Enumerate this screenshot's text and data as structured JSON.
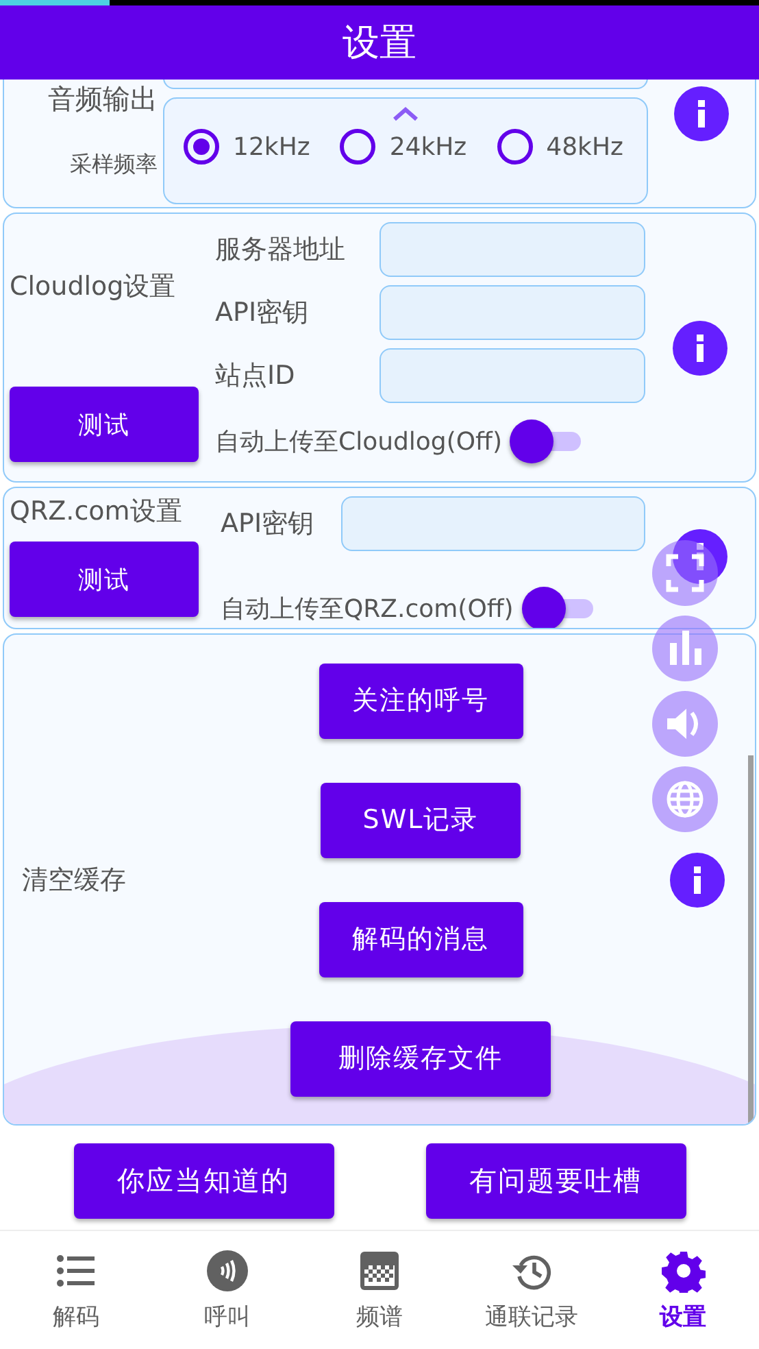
{
  "title": "设置",
  "audio_output": {
    "label": "音频输出"
  },
  "sample_rate": {
    "label": "采样频率",
    "options": [
      {
        "label": "12kHz",
        "selected": true
      },
      {
        "label": "24kHz",
        "selected": false
      },
      {
        "label": "48kHz",
        "selected": false
      }
    ]
  },
  "cloudlog": {
    "title": "Cloudlog设置",
    "test_button": "测试",
    "fields": [
      {
        "label": "服务器地址"
      },
      {
        "label": "API密钥"
      },
      {
        "label": "站点ID"
      }
    ],
    "auto_upload": {
      "label": "自动上传至Cloudlog(Off)",
      "on": false
    }
  },
  "qrz": {
    "title": "QRZ.com设置",
    "test_button": "测试",
    "fields": [
      {
        "label": "API密钥"
      }
    ],
    "auto_upload": {
      "label": "自动上传至QRZ.com(Off)",
      "on": false
    }
  },
  "cache": {
    "label": "清空缓存",
    "buttons": [
      "关注的呼号",
      "SWL记录",
      "解码的消息",
      "删除缓存文件"
    ]
  },
  "footer_buttons": [
    "你应当知道的",
    "有问题要吐槽"
  ],
  "nav": [
    {
      "label": "解码",
      "selected": false
    },
    {
      "label": "呼叫",
      "selected": false
    },
    {
      "label": "频谱",
      "selected": false
    },
    {
      "label": "通联记录",
      "selected": false
    },
    {
      "label": "设置",
      "selected": true
    }
  ]
}
